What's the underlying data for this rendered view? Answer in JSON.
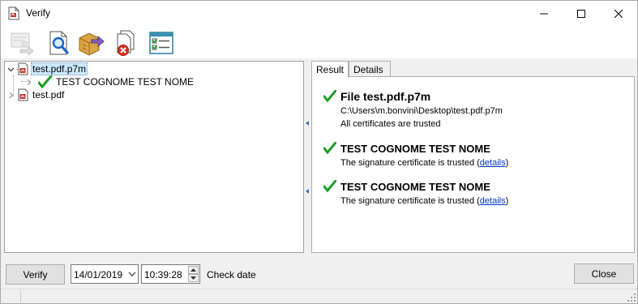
{
  "window": {
    "title": "Verify"
  },
  "toolbar": {
    "items": [
      {
        "icon": "certificate-arrow-icon",
        "enabled": false
      },
      {
        "icon": "magnifier-document-icon",
        "enabled": true
      },
      {
        "icon": "export-box-icon",
        "enabled": true
      },
      {
        "icon": "remove-documents-icon",
        "enabled": true
      },
      {
        "icon": "checklist-icon",
        "enabled": true
      }
    ]
  },
  "tree": {
    "items": [
      {
        "label": "test.pdf.p7m",
        "icon": "pdf-file-icon",
        "expanded": true,
        "selected": true
      },
      {
        "label": "TEST COGNOME TEST NOME",
        "icon": "green-check-icon",
        "expanded": false
      },
      {
        "label": "test.pdf",
        "icon": "pdf-file-icon",
        "expanded": false
      }
    ]
  },
  "tabs": [
    {
      "label": "Result",
      "active": true
    },
    {
      "label": "Details",
      "active": false
    }
  ],
  "result": {
    "file": {
      "title": "File test.pdf.p7m",
      "path": "C:\\Users\\m.bonvini\\Desktop\\test.pdf.p7m",
      "status": "All certificates are trusted"
    },
    "signers": [
      {
        "name": "TEST COGNOME TEST NOME",
        "status_prefix": "The signature certificate is trusted (",
        "link": "details",
        "status_suffix": ")"
      },
      {
        "name": "TEST COGNOME TEST NOME",
        "status_prefix": "The signature certificate is trusted (",
        "link": "details",
        "status_suffix": ")"
      }
    ]
  },
  "footer": {
    "verify_label": "Verify",
    "date_value": "14/01/2019",
    "time_value": "10:39:28",
    "check_date_label": "Check date",
    "close_label": "Close"
  },
  "colors": {
    "accent": "#0078d7",
    "check_green": "#1e9c2a",
    "link": "#0033cc",
    "selection": "#cce8ff"
  }
}
